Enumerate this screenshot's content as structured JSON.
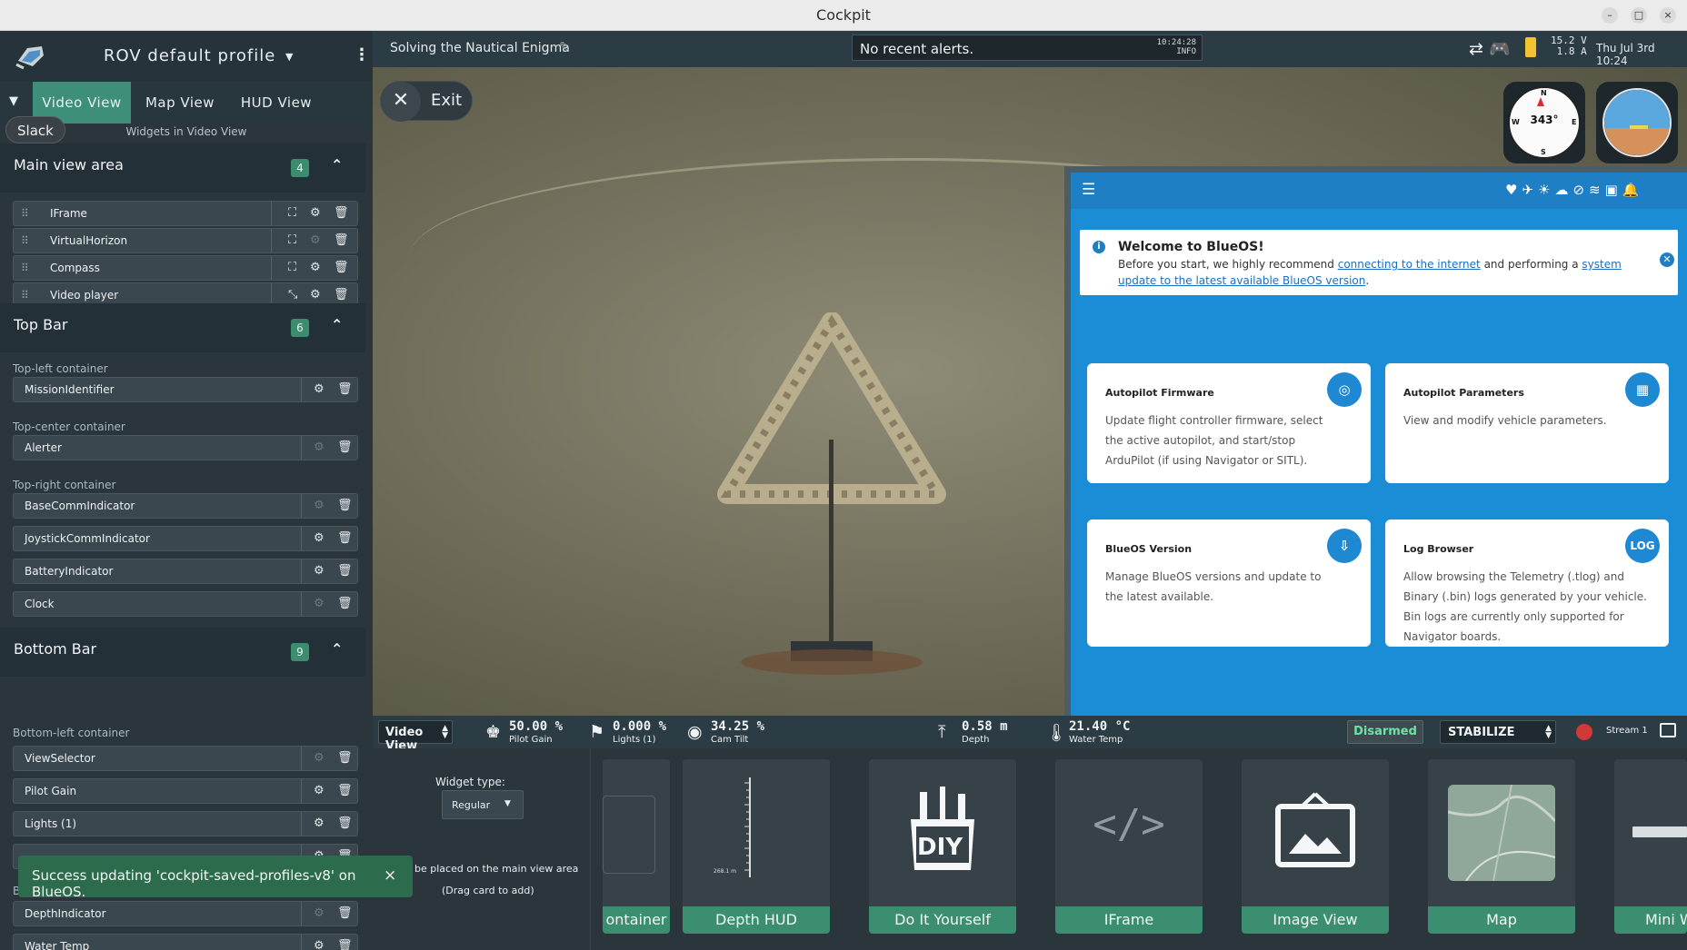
{
  "window": {
    "title": "Cockpit",
    "min": "–",
    "max": "□",
    "close": "×"
  },
  "sidebar": {
    "profile_name": "ROV default profile",
    "tabs": [
      {
        "label": "Video View"
      },
      {
        "label": "Map View"
      },
      {
        "label": "HUD View"
      }
    ],
    "caption": "Widgets in Video View",
    "tooltip": "Slack",
    "main_view": {
      "title": "Main view area",
      "count": "4",
      "widgets": [
        {
          "name": "IFrame"
        },
        {
          "name": "VirtualHorizon"
        },
        {
          "name": "Compass"
        },
        {
          "name": "Video player"
        }
      ]
    },
    "top_bar": {
      "title": "Top Bar",
      "count": "6",
      "containers": [
        {
          "label": "Top-left container",
          "widgets": [
            {
              "name": "MissionIdentifier"
            }
          ]
        },
        {
          "label": "Top-center container",
          "widgets": [
            {
              "name": "Alerter"
            }
          ]
        },
        {
          "label": "Top-right container",
          "widgets": [
            {
              "name": "BaseCommIndicator"
            },
            {
              "name": "JoystickCommIndicator"
            },
            {
              "name": "BatteryIndicator"
            },
            {
              "name": "Clock"
            }
          ]
        }
      ]
    },
    "bottom_bar": {
      "title": "Bottom Bar",
      "count": "9",
      "container_label": "Bottom-left container",
      "widgets": [
        {
          "name": "ViewSelector"
        },
        {
          "name": "Pilot Gain"
        },
        {
          "name": "Lights (1)"
        },
        {
          "name": "DepthIndicator"
        },
        {
          "name": "Water Temp"
        }
      ],
      "partial_label": "B"
    },
    "toast": {
      "message": "Success updating 'cockpit-saved-profiles-v8' on BlueOS.",
      "close": "×"
    }
  },
  "topbar": {
    "mission": "Solving the Nautical Enigma",
    "alert": {
      "message": "No recent alerts.",
      "time": "10:24:28",
      "level": "INFO"
    },
    "voltage": "15.2 V",
    "current": "1.8 A",
    "clock": "Thu Jul 3rd 10:24"
  },
  "video": {
    "exit_label": "Exit",
    "compass": {
      "heading": "343°",
      "n": "N",
      "s": "S",
      "e": "E",
      "w": "W"
    }
  },
  "blueos": {
    "welcome_title": "Welcome to BlueOS!",
    "welcome_text_1": "Before you start, we highly recommend ",
    "welcome_link_1": "connecting to the internet",
    "welcome_text_2": " and performing a ",
    "welcome_link_2": "system update to the latest available BlueOS version",
    "welcome_text_3": ".",
    "cards": [
      {
        "title": "Autopilot Firmware",
        "desc": "Update flight controller firmware, select the active autopilot, and start/stop ArduPilot (if using Navigator or SITL).",
        "icon": "◎"
      },
      {
        "title": "Autopilot Parameters",
        "desc": "View and modify vehicle parameters.",
        "icon": "▦"
      },
      {
        "title": "BlueOS Version",
        "desc": "Manage BlueOS versions and update to the latest available.",
        "icon": "⇩"
      },
      {
        "title": "Log Browser",
        "desc": "Allow browsing the Telemetry (.tlog) and Binary (.bin) logs generated by your vehicle. Bin logs are currently only supported for Navigator boards.",
        "icon": "LOG"
      }
    ]
  },
  "bottombar": {
    "view_selector": "Video View",
    "pilot_gain": {
      "value": "50.00 %",
      "label": "Pilot Gain"
    },
    "lights": {
      "value": "0.000 %",
      "label": "Lights (1)"
    },
    "cam_tilt": {
      "value": "34.25 %",
      "label": "Cam Tilt"
    },
    "depth": {
      "value": "0.58 m",
      "label": "Depth"
    },
    "water_temp": {
      "value": "21.40 °C",
      "label": "Water Temp"
    },
    "arm_state": "Disarmed",
    "flight_mode": "STABILIZE",
    "stream": "Stream 1"
  },
  "tray": {
    "widget_type_label": "Widget type:",
    "widget_type_value": "Regular",
    "hint1": "be placed on the main view area",
    "hint2": "(Drag card to add)",
    "cards": [
      {
        "label": "ontainer"
      },
      {
        "label": "Depth HUD"
      },
      {
        "label": "Do It Yourself"
      },
      {
        "label": "IFrame"
      },
      {
        "label": "Image View"
      },
      {
        "label": "Map"
      },
      {
        "label": "Mini W"
      }
    ],
    "depth_hud_value": "268.1 m",
    "diy_text": "DIY"
  }
}
